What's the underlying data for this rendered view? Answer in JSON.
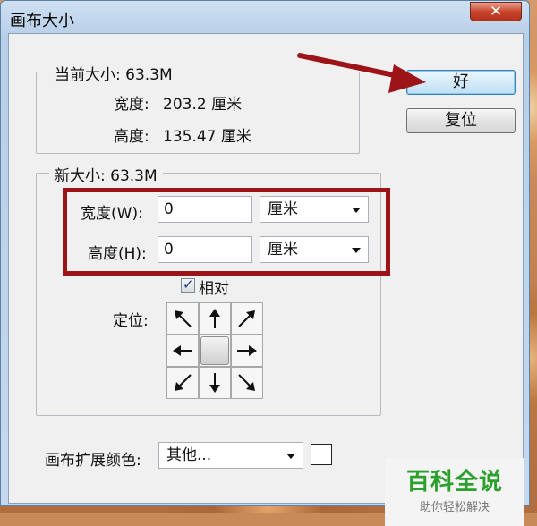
{
  "dialog": {
    "title": "画布大小",
    "close_glyph": "✕"
  },
  "current_size": {
    "legend": "当前大小: 63.3M",
    "width_label": "宽度:",
    "width_value": "203.2 厘米",
    "height_label": "高度:",
    "height_value": "135.47 厘米"
  },
  "new_size": {
    "legend": "新大小: 63.3M",
    "width_label": "宽度(W):",
    "width_value": "0",
    "width_unit": "厘米",
    "height_label": "高度(H):",
    "height_value": "0",
    "height_unit": "厘米",
    "relative_label": "相对",
    "relative_checked": true,
    "anchor_label": "定位:"
  },
  "buttons": {
    "ok": "好",
    "reset": "复位"
  },
  "extension_color": {
    "label": "画布扩展颜色:",
    "value": "其他...",
    "swatch_color": "#ffffff"
  },
  "anchor_icons": [
    "arrow-up-left-icon",
    "arrow-up-icon",
    "arrow-up-right-icon",
    "arrow-left-icon",
    "anchor-center",
    "arrow-right-icon",
    "arrow-down-left-icon",
    "arrow-down-icon",
    "arrow-down-right-icon"
  ],
  "watermark": {
    "main": "百科全说",
    "sub": "助你轻松解决"
  },
  "annotation_color": "#9c1418"
}
